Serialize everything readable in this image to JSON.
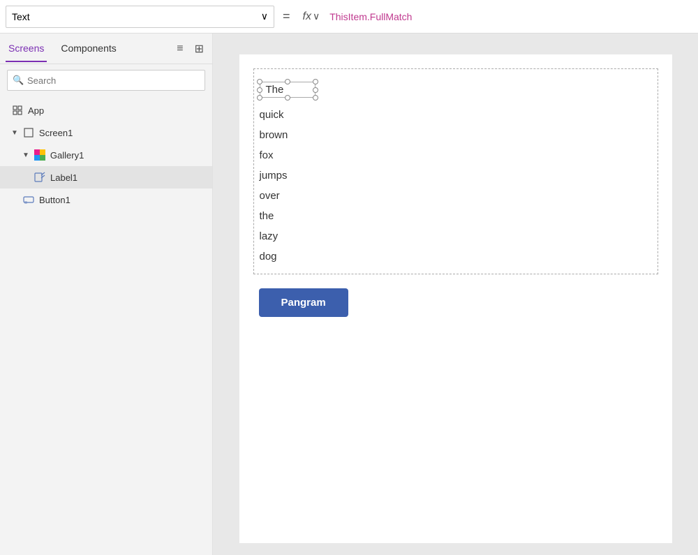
{
  "formulaBar": {
    "propertyLabel": "Text",
    "equalsSign": "=",
    "fxLabel": "fx",
    "chevronLabel": "∨",
    "formula": "ThisItem.FullMatch"
  },
  "sidebar": {
    "tab1": "Screens",
    "tab2": "Components",
    "listIconLabel": "≡",
    "gridIconLabel": "⊞",
    "searchPlaceholder": "Search",
    "treeItems": [
      {
        "id": "app",
        "label": "App",
        "icon": "app",
        "indent": 0,
        "hasChevron": false
      },
      {
        "id": "screen1",
        "label": "Screen1",
        "icon": "screen",
        "indent": 1,
        "hasChevron": true,
        "expanded": true
      },
      {
        "id": "gallery1",
        "label": "Gallery1",
        "icon": "gallery",
        "indent": 2,
        "hasChevron": true,
        "expanded": true
      },
      {
        "id": "label1",
        "label": "Label1",
        "icon": "label",
        "indent": 3,
        "hasChevron": false,
        "selected": true
      },
      {
        "id": "button1",
        "label": "Button1",
        "icon": "button",
        "indent": 2,
        "hasChevron": false
      }
    ]
  },
  "canvas": {
    "galleryItems": [
      "The",
      "quick",
      "brown",
      "fox",
      "jumps",
      "over",
      "the",
      "lazy",
      "dog"
    ],
    "selectedItem": "The",
    "buttonLabel": "Pangram"
  }
}
